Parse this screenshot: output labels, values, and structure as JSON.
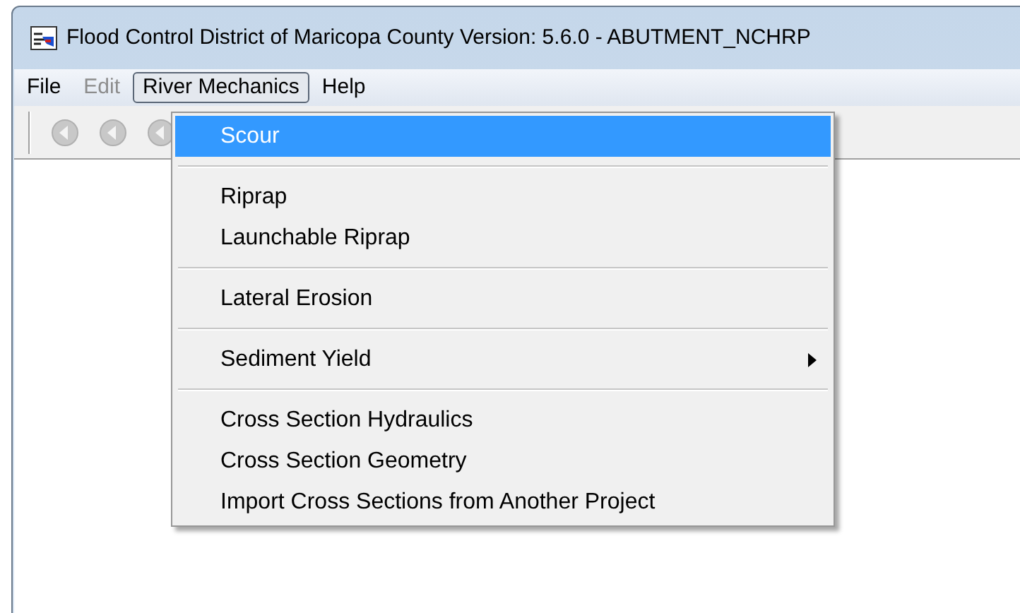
{
  "window": {
    "title": "Flood Control District of Maricopa County Version: 5.6.0 - ABUTMENT_NCHRP"
  },
  "menubar": [
    {
      "label": "File",
      "disabled": false,
      "selected": false
    },
    {
      "label": "Edit",
      "disabled": true,
      "selected": false
    },
    {
      "label": "River Mechanics",
      "disabled": false,
      "selected": true
    },
    {
      "label": "Help",
      "disabled": false,
      "selected": false
    }
  ],
  "menu": {
    "items": [
      {
        "kind": "item",
        "label": "Scour",
        "selected": true,
        "submenu": false
      },
      {
        "kind": "separator"
      },
      {
        "kind": "item",
        "label": "Riprap",
        "selected": false,
        "submenu": false
      },
      {
        "kind": "item",
        "label": "Launchable Riprap",
        "selected": false,
        "submenu": false
      },
      {
        "kind": "separator"
      },
      {
        "kind": "item",
        "label": "Lateral Erosion",
        "selected": false,
        "submenu": false
      },
      {
        "kind": "separator"
      },
      {
        "kind": "item",
        "label": "Sediment Yield",
        "selected": false,
        "submenu": true
      },
      {
        "kind": "separator"
      },
      {
        "kind": "item",
        "label": "Cross Section Hydraulics",
        "selected": false,
        "submenu": false
      },
      {
        "kind": "item",
        "label": "Cross Section Geometry",
        "selected": false,
        "submenu": false
      },
      {
        "kind": "item",
        "label": "Import Cross Sections from Another Project",
        "selected": false,
        "submenu": false
      }
    ]
  }
}
